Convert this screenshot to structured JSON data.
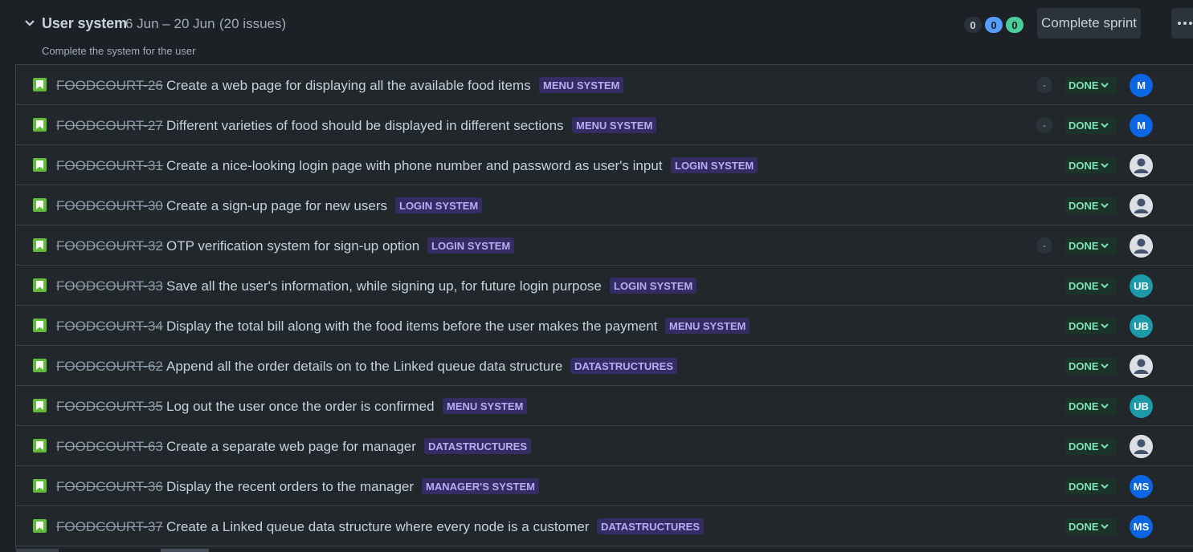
{
  "sprint": {
    "name": "User system",
    "dates": "6 Jun – 20 Jun",
    "issue_count": "(20 issues)",
    "goal": "Complete the system for the user",
    "counts": {
      "todo": "0",
      "in_progress": "0",
      "done": "0"
    },
    "complete_label": "Complete sprint"
  },
  "colors": {
    "background": "#1d2125",
    "row_background": "#22272b",
    "story": "#63ba3c",
    "epic_bg": "#352c63",
    "epic_text": "#b8acf6",
    "done_bg": "#1c3329",
    "done_text": "#7ee2b8"
  },
  "issues": [
    {
      "key": "FOODCOURT-26",
      "summary": "Create a web page for displaying all the available food items",
      "epic": "MENU SYSTEM",
      "estimate": "-",
      "status": "DONE",
      "avatar": "M",
      "avatar_color": "#0c66e4"
    },
    {
      "key": "FOODCOURT-27",
      "summary": "Different varieties of food should be displayed in different sections",
      "epic": "MENU SYSTEM",
      "estimate": "-",
      "status": "DONE",
      "avatar": "M",
      "avatar_color": "#0c66e4"
    },
    {
      "key": "FOODCOURT-31",
      "summary": "Create a nice-looking login page with phone number and password as user's input",
      "epic": "LOGIN SYSTEM",
      "estimate": "",
      "status": "DONE",
      "avatar": "",
      "avatar_color": ""
    },
    {
      "key": "FOODCOURT-30",
      "summary": "Create a sign-up page for new users",
      "epic": "LOGIN SYSTEM",
      "estimate": "",
      "status": "DONE",
      "avatar": "",
      "avatar_color": ""
    },
    {
      "key": "FOODCOURT-32",
      "summary": "OTP verification system for sign-up option",
      "epic": "LOGIN SYSTEM",
      "estimate": "-",
      "status": "DONE",
      "avatar": "",
      "avatar_color": ""
    },
    {
      "key": "FOODCOURT-33",
      "summary": "Save all the user's information, while signing up, for future login purpose",
      "epic": "LOGIN SYSTEM",
      "estimate": "",
      "status": "DONE",
      "avatar": "UB",
      "avatar_color": "#1d9aaa"
    },
    {
      "key": "FOODCOURT-34",
      "summary": "Display the total bill along with the food items before the user makes the payment",
      "epic": "MENU SYSTEM",
      "estimate": "",
      "status": "DONE",
      "avatar": "UB",
      "avatar_color": "#1d9aaa"
    },
    {
      "key": "FOODCOURT-62",
      "summary": "Append all the order details on to the Linked queue data structure",
      "epic": "DATASTRUCTURES",
      "estimate": "",
      "status": "DONE",
      "avatar": "",
      "avatar_color": ""
    },
    {
      "key": "FOODCOURT-35",
      "summary": "Log out the user once the order is confirmed",
      "epic": "MENU SYSTEM",
      "estimate": "",
      "status": "DONE",
      "avatar": "UB",
      "avatar_color": "#1d9aaa"
    },
    {
      "key": "FOODCOURT-63",
      "summary": "Create a separate web page for manager",
      "epic": "DATASTRUCTURES",
      "estimate": "",
      "status": "DONE",
      "avatar": "",
      "avatar_color": ""
    },
    {
      "key": "FOODCOURT-36",
      "summary": "Display the recent orders to the manager",
      "epic": "MANAGER'S SYSTEM",
      "estimate": "",
      "status": "DONE",
      "avatar": "MS",
      "avatar_color": "#0c66e4"
    },
    {
      "key": "FOODCOURT-37",
      "summary": "Create a Linked queue data structure where every node is a customer",
      "epic": "DATASTRUCTURES",
      "estimate": "",
      "status": "DONE",
      "avatar": "MS",
      "avatar_color": "#0c66e4"
    }
  ]
}
